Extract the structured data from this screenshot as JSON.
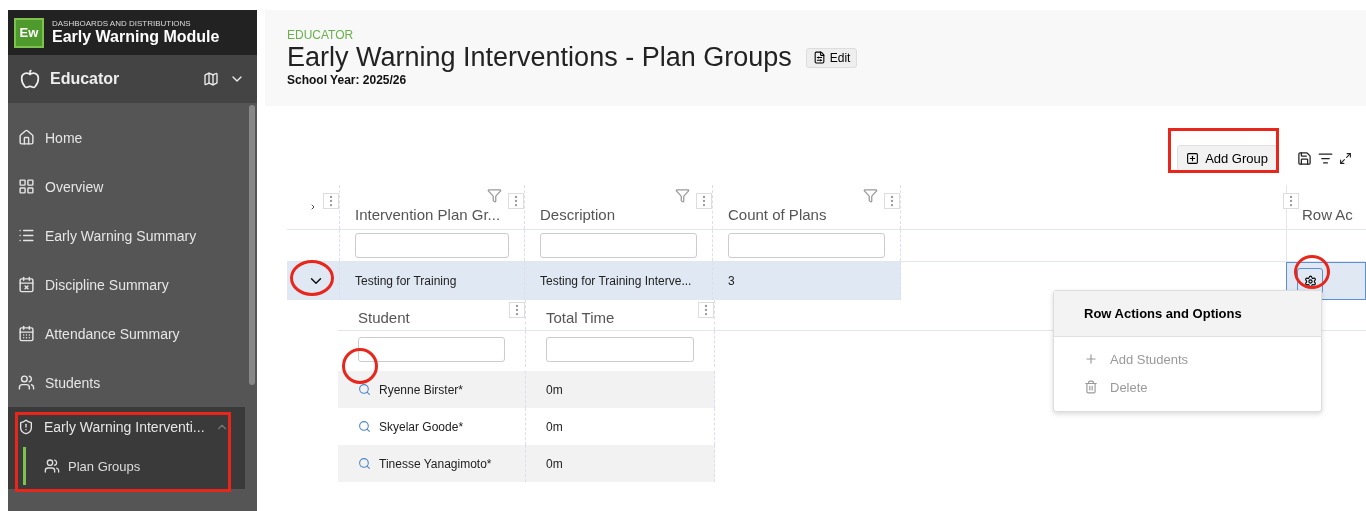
{
  "app": {
    "logo": "Ew",
    "suptitle": "DASHBOARDS AND DISTRIBUTIONS",
    "title": "Early Warning Module"
  },
  "role": {
    "label": "Educator"
  },
  "sidebar": {
    "items": [
      {
        "label": "Home",
        "selected": false
      },
      {
        "label": "Overview",
        "selected": false
      },
      {
        "label": "Early Warning Summary",
        "selected": false
      },
      {
        "label": "Discipline Summary",
        "selected": false
      },
      {
        "label": "Attendance Summary",
        "selected": false
      },
      {
        "label": "Students",
        "selected": false
      },
      {
        "label": "Early Warning Interventi...",
        "selected": false,
        "expanded": true,
        "children": [
          {
            "label": "Plan Groups",
            "selected": true
          }
        ]
      }
    ]
  },
  "header": {
    "eyebrow": "EDUCATOR",
    "title": "Early Warning Interventions - Plan Groups",
    "edit_button": "Edit",
    "school_year": "School Year: 2025/26"
  },
  "toolbar": {
    "add_button": "Add Group"
  },
  "grid": {
    "columns": [
      "Intervention Plan Gr...",
      "Description",
      "Count of Plans",
      "Row Ac"
    ],
    "rows": [
      {
        "expanded": true,
        "selected": true,
        "cells": [
          "Testing for Training",
          "Testing for Training Interve...",
          "3"
        ],
        "detail": {
          "columns": [
            "Student",
            "Total Time"
          ],
          "rows": [
            {
              "cells": [
                "Ryenne Birster*",
                "0m"
              ]
            },
            {
              "cells": [
                "Skyelar Goode*",
                "0m"
              ]
            },
            {
              "cells": [
                "Tinesse Yanagimoto*",
                "0m"
              ]
            }
          ]
        }
      }
    ]
  },
  "menu": {
    "title": "Row Actions and Options",
    "items": [
      "Add Students",
      "Delete"
    ]
  }
}
